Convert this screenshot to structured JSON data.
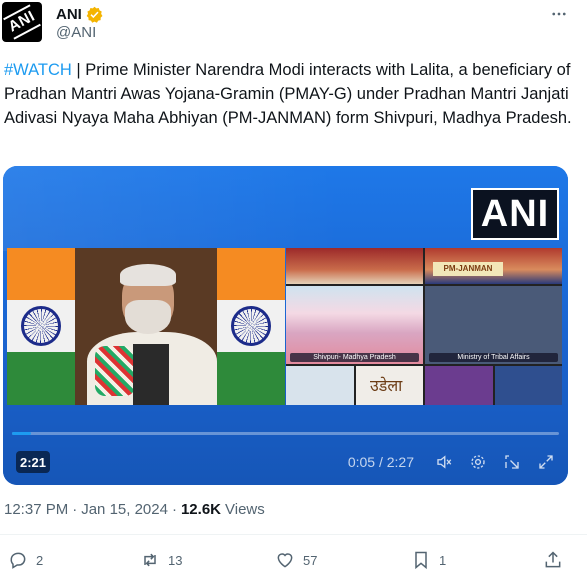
{
  "author": {
    "display_name": "ANI",
    "handle": "@ANI",
    "avatar_text": "ANI",
    "verified_color": "#f4b400"
  },
  "tweet": {
    "hashtag": "#WATCH",
    "text": " | Prime Minister Narendra Modi interacts with Lalita, a beneficiary of Pradhan Mantri Awas Yojana-Gramin (PMAY-G) under Pradhan Mantri Janjati Adivasi Nyaya Maha Abhiyan (PM-JANMAN) form Shivpuri, Madhya Pradesh."
  },
  "video": {
    "watermark": "ANI",
    "duration_badge": "2:21",
    "time_readout": "0:05 / 2:27",
    "progress": 0.034,
    "panel_labels": {
      "shivpuri": "Shivpuri- Madhya Pradesh",
      "ministry": "Ministry of Tribal Affairs",
      "pm_janman": "PM-JANMAN",
      "hindi": "उडेला"
    },
    "icons": [
      "volume-mute-icon",
      "settings-icon",
      "popout-icon",
      "fullscreen-icon"
    ]
  },
  "meta": {
    "time": "12:37 PM",
    "date": "Jan 15, 2024",
    "views_count": "12.6K",
    "views_label": "Views"
  },
  "actions": {
    "replies": "2",
    "retweets": "13",
    "likes": "57",
    "bookmarks": "1"
  },
  "colors": {
    "accent": "#1d9bf0",
    "text": "#0f1419",
    "muted": "#536471"
  }
}
